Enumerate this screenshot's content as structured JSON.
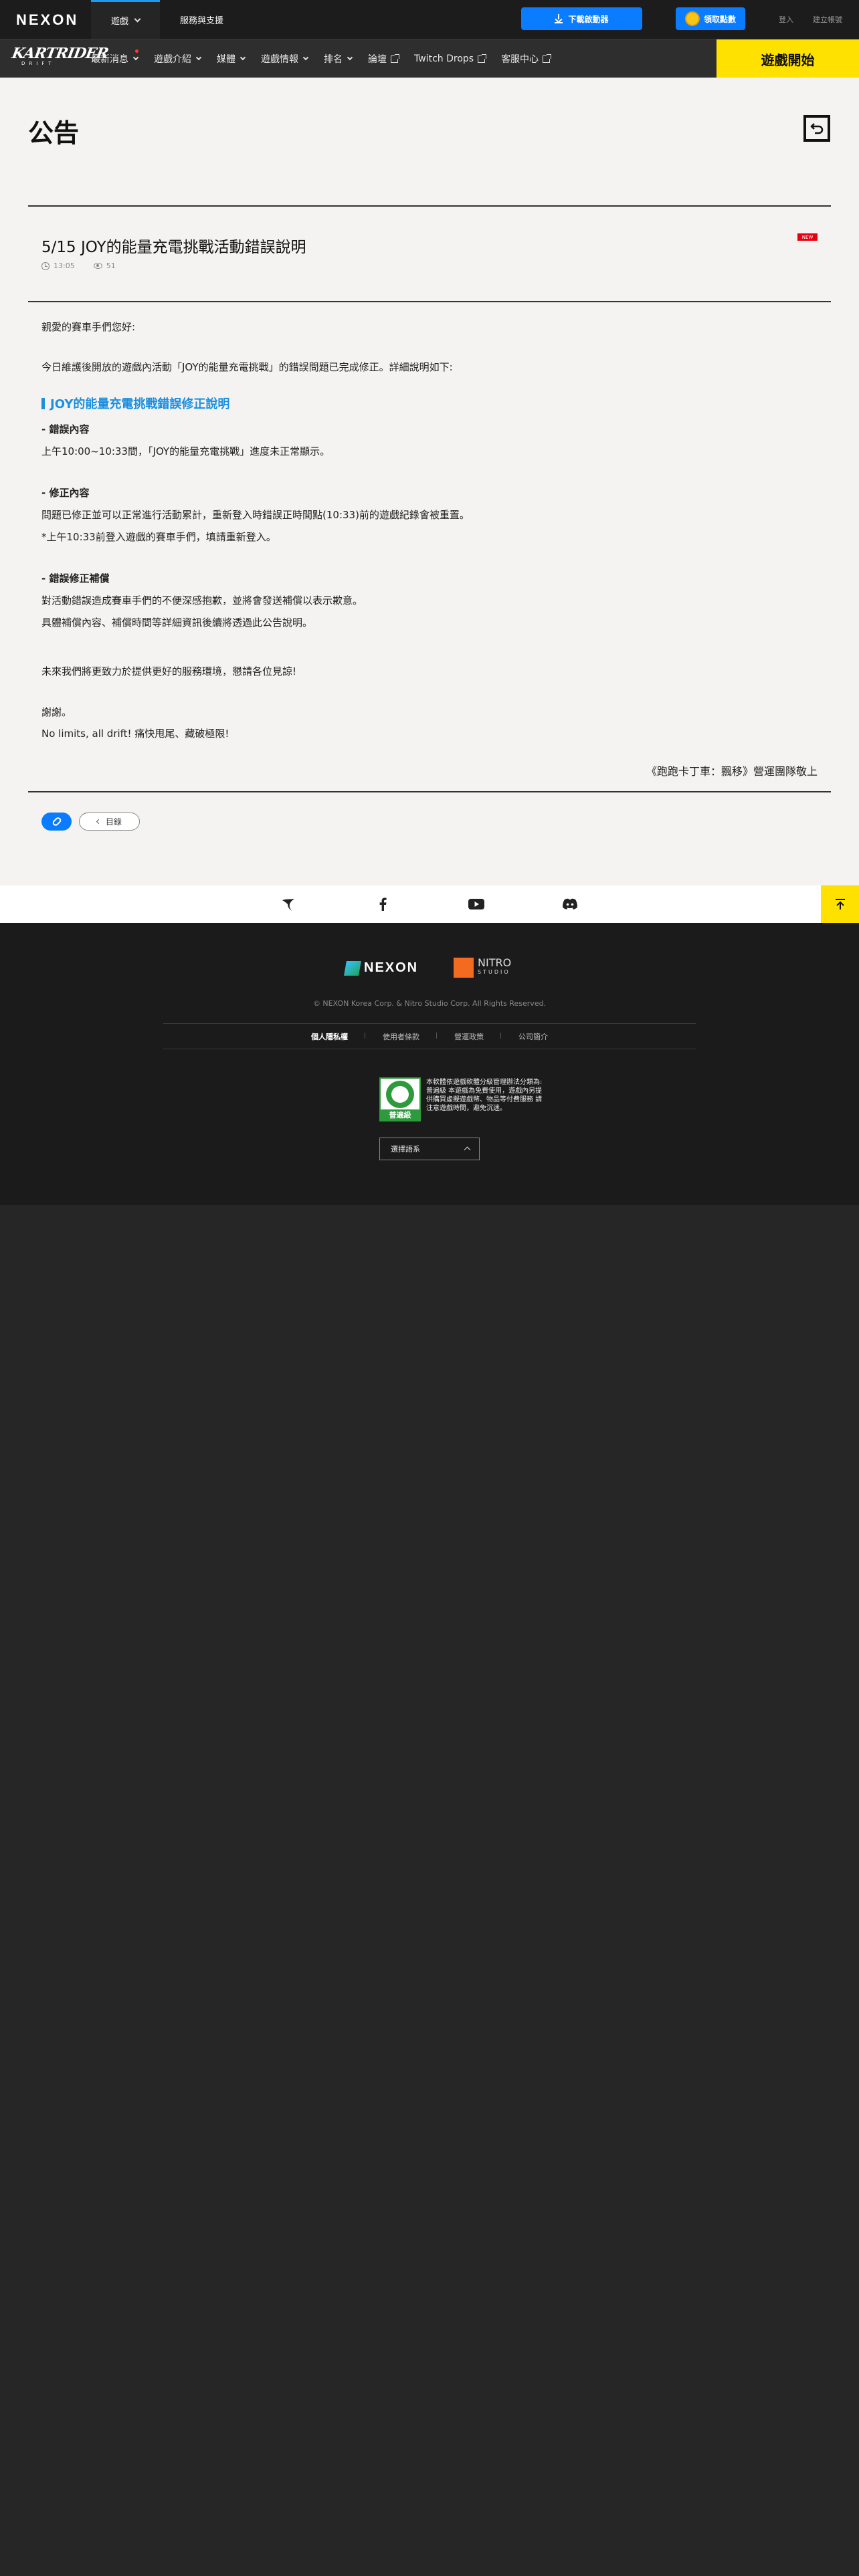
{
  "topbar": {
    "logo": "NEXON",
    "menu": [
      {
        "label": "遊戲"
      },
      {
        "label": "服務與支援"
      }
    ],
    "download_label": "下載啟動器",
    "points_label": "領取點數",
    "login": "登入",
    "signup": "建立帳號"
  },
  "gamenav": {
    "logo_word": "KARTRIDER",
    "logo_sub": "DRIFT",
    "items": [
      {
        "label": "最新消息"
      },
      {
        "label": "遊戲介紹"
      },
      {
        "label": "媒體"
      },
      {
        "label": "遊戲情報"
      },
      {
        "label": "排名"
      },
      {
        "label": "論壇"
      },
      {
        "label": "Twitch Drops"
      },
      {
        "label": "客服中心"
      }
    ],
    "play_label": "遊戲開始"
  },
  "page": {
    "title": "公告"
  },
  "article": {
    "title": "5/15 JOY的能量充電挑戰活動錯誤說明",
    "badge": "NEW",
    "time": "13:05",
    "views": "51",
    "greeting": "親愛的賽車手們您好:",
    "intro": "今日維護後開放的遊戲內活動「JOY的能量充電挑戰」的錯誤問題已完成修正。詳細說明如下:",
    "section_heading": "JOY的能量充電挑戰錯誤修正說明",
    "error_title": "- 錯誤內容",
    "error_text": "上午10:00~10:33間，「JOY的能量充電挑戰」進度未正常顯示。",
    "fix_title": "- 修正內容",
    "fix_text1": "問題已修正並可以正常進行活動累計，重新登入時錯誤正時間點(10:33)前的遊戲紀錄會被重置。",
    "fix_text2": "*上午10:33前登入遊戲的賽車手們，填請重新登入。",
    "comp_title": "- 錯誤修正補償",
    "comp_text1": "對活動錯誤造成賽車手們的不便深感抱歉，並將會發送補償以表示歉意。",
    "comp_text2": "具體補償內容、補償時間等詳細資訊後續將透過此公告說明。",
    "closing": "未來我們將更致力於提供更好的服務環境，懇請各位見諒!",
    "thanks": "謝謝。",
    "slogan": "No limits, all drift! 痛快甩尾、藏破極限!",
    "signature": "《跑跑卡丁車：飄移》營運團隊敬上",
    "list_label": "目錄"
  },
  "footer": {
    "nexon": "NEXON",
    "nitro": "NITRO",
    "nitro_sub": "STUDIO",
    "copyright": "© NEXON Korea Corp. & Nitro Studio Corp. All Rights Reserved.",
    "links": [
      {
        "label": "個人隱私權"
      },
      {
        "label": "使用者條款"
      },
      {
        "label": "營運政策"
      },
      {
        "label": "公司簡介"
      }
    ],
    "rating_label": "普遍級",
    "rating_text": "本軟體依遊戲軟體分級管理辦法分類為:普遍級 本遊戲為免費使用，遊戲內另提供購買虛擬遊戲幣、物品等付費服務 請注意遊戲時間，避免沉迷。",
    "language": "選擇語系"
  },
  "colors": {
    "accent_blue": "#0a7cff",
    "play_yellow": "#ffe100",
    "heading_blue": "#1a8fe0"
  }
}
